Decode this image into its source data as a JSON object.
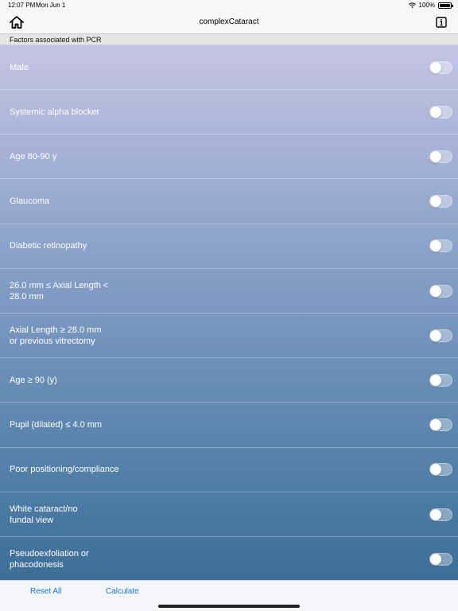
{
  "status_bar": {
    "time": "12:07 PM",
    "date": "Mon Jun 1",
    "battery": "100%"
  },
  "nav": {
    "title": "complexCataract",
    "home_icon": "house-icon",
    "info_icon": "info-icon"
  },
  "section": {
    "header": "Factors associated with PCR"
  },
  "factors": [
    {
      "label": "Male",
      "on": false
    },
    {
      "label": "Systemic alpha blocker",
      "on": false
    },
    {
      "label": "Age 80-90 y",
      "on": false
    },
    {
      "label": "Glaucoma",
      "on": false
    },
    {
      "label": "Diabetic retinopathy",
      "on": false
    },
    {
      "label": "26.0 mm ≤ Axial Length <\n28.0 mm",
      "on": false
    },
    {
      "label": "Axial Length ≥ 28.0 mm\nor previous vitrectomy",
      "on": false
    },
    {
      "label": "Age ≥ 90 (y)",
      "on": false
    },
    {
      "label": "Pupil (dilated) ≤ 4.0 mm",
      "on": false
    },
    {
      "label": "Poor positioning/compliance",
      "on": false
    },
    {
      "label": "White cataract/no\nfundal view",
      "on": false
    },
    {
      "label": "Pseudoexfoliation or\nphacodonesis",
      "on": false
    }
  ],
  "toolbar": {
    "reset_label": "Reset All",
    "calculate_label": "Calculate"
  },
  "colors": {
    "accent": "#1477d6",
    "gradient_top": "#c4c5e4",
    "gradient_bottom": "#3c6e97"
  }
}
